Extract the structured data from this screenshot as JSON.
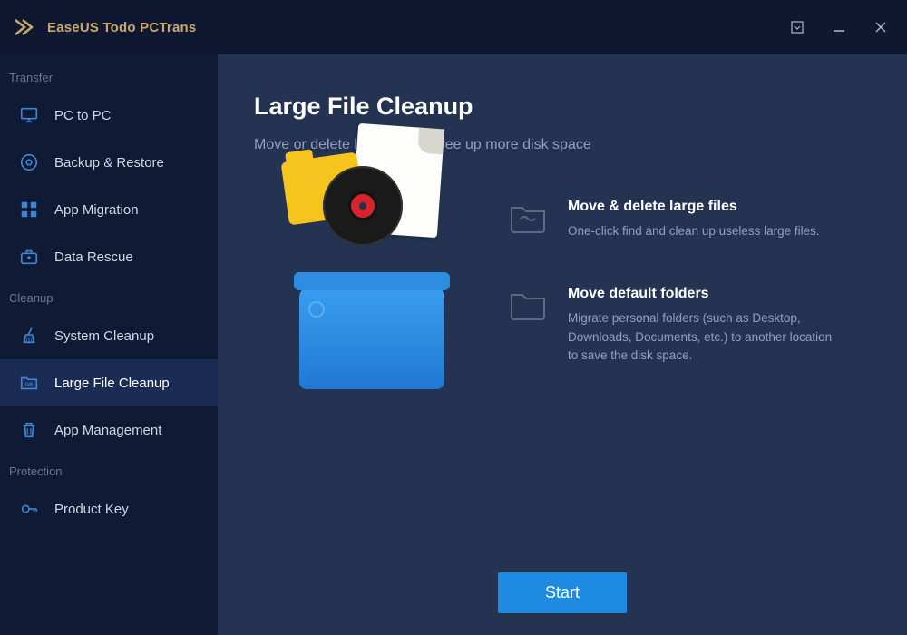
{
  "app": {
    "title": "EaseUS Todo PCTrans"
  },
  "sidebar": {
    "sections": [
      {
        "label": "Transfer",
        "items": [
          {
            "label": "PC to PC",
            "icon": "monitor-icon"
          },
          {
            "label": "Backup & Restore",
            "icon": "disc-icon"
          },
          {
            "label": "App Migration",
            "icon": "grid-icon"
          },
          {
            "label": "Data Rescue",
            "icon": "briefcase-icon"
          }
        ]
      },
      {
        "label": "Cleanup",
        "items": [
          {
            "label": "System Cleanup",
            "icon": "broom-icon"
          },
          {
            "label": "Large File Cleanup",
            "icon": "folder-gb-icon",
            "selected": true
          },
          {
            "label": "App Management",
            "icon": "trash-icon"
          }
        ]
      },
      {
        "label": "Protection",
        "items": [
          {
            "label": "Product Key",
            "icon": "key-icon"
          }
        ]
      }
    ]
  },
  "main": {
    "title": "Large File Cleanup",
    "subtitle": "Move or delete large files to free up more disk space",
    "features": [
      {
        "title": "Move & delete large files",
        "desc": "One-click find and clean up useless large files."
      },
      {
        "title": "Move default folders",
        "desc": "Migrate personal folders (such as Desktop, Downloads, Documents, etc.) to another location to save the disk space."
      }
    ],
    "start_label": "Start"
  }
}
